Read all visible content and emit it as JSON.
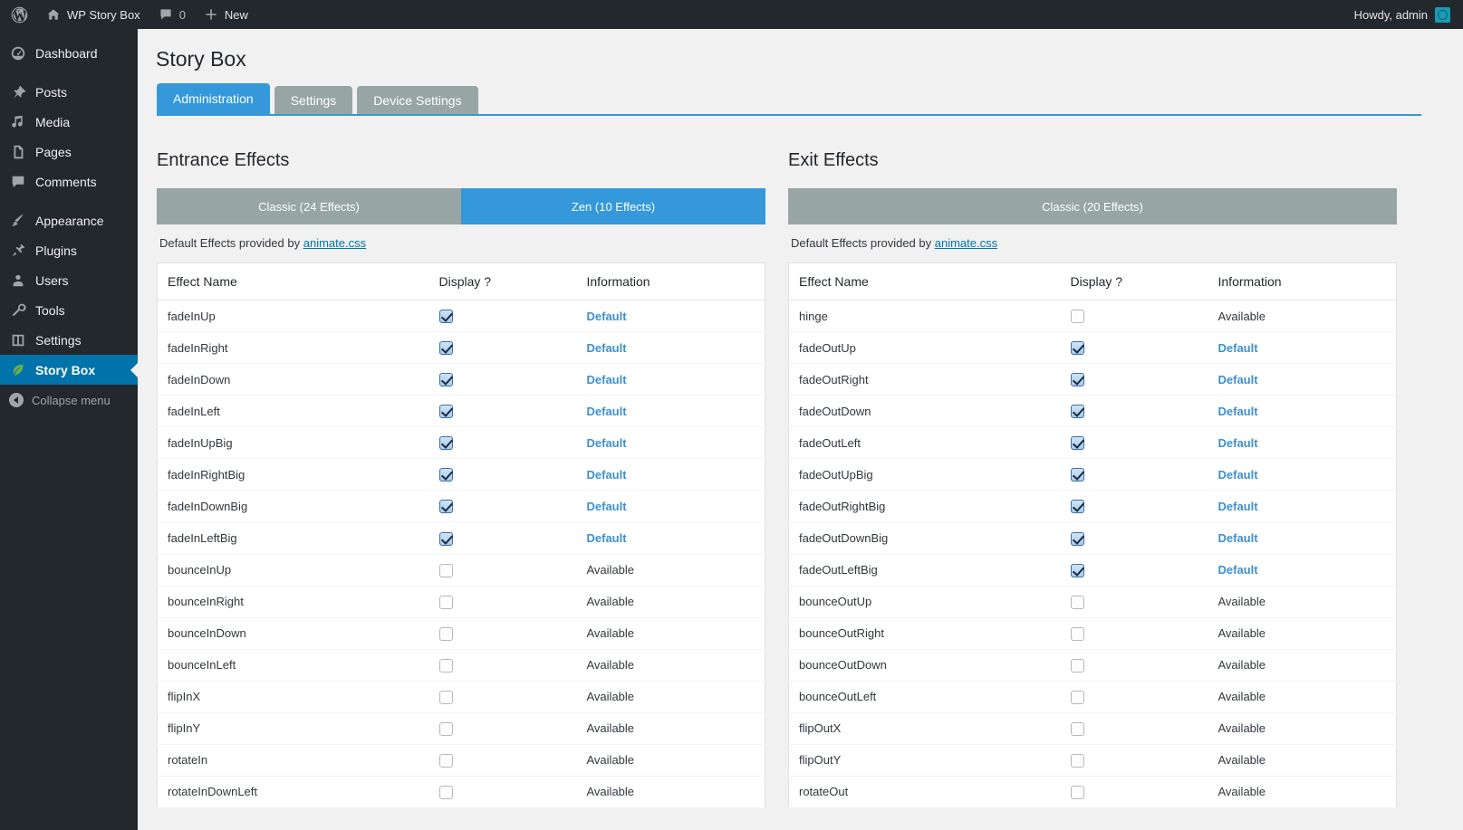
{
  "adminbar": {
    "logo_icon": "wordpress-logo-icon",
    "site_name": "WP Story Box",
    "site_icon": "home-icon",
    "comments_icon": "comment-bubble-icon",
    "comments_count": "0",
    "new_icon": "plus-icon",
    "new_label": "New",
    "howdy": "Howdy, admin",
    "avatar_icon": "user-avatar-icon"
  },
  "sidebar": {
    "items": [
      {
        "label": "Dashboard",
        "icon": "dashboard-icon",
        "current": false
      },
      {
        "label": "Posts",
        "icon": "pin-icon",
        "current": false
      },
      {
        "label": "Media",
        "icon": "media-icon",
        "current": false
      },
      {
        "label": "Pages",
        "icon": "pages-icon",
        "current": false
      },
      {
        "label": "Comments",
        "icon": "comment-bubble-icon",
        "current": false
      },
      {
        "label": "Appearance",
        "icon": "paintbrush-icon",
        "current": false
      },
      {
        "label": "Plugins",
        "icon": "plug-icon",
        "current": false
      },
      {
        "label": "Users",
        "icon": "user-icon",
        "current": false
      },
      {
        "label": "Tools",
        "icon": "wrench-icon",
        "current": false
      },
      {
        "label": "Settings",
        "icon": "sliders-icon",
        "current": false
      },
      {
        "label": "Story Box",
        "icon": "leaf-icon",
        "current": true
      }
    ],
    "collapse_label": "Collapse menu",
    "collapse_icon": "collapse-arrow-icon"
  },
  "page": {
    "title": "Story Box",
    "tabs": [
      {
        "label": "Administration",
        "active": true
      },
      {
        "label": "Settings",
        "active": false
      },
      {
        "label": "Device Settings",
        "active": false
      }
    ]
  },
  "colors": {
    "accent_blue": "#3498db",
    "tab_inactive_gray": "#97a5a5",
    "sidebar_current": "#0073aa",
    "link_blue": "#0073aa",
    "default_label": "#3d90d0",
    "admin_bar": "#23282d"
  },
  "columns": [
    {
      "title": "Entrance Effects",
      "toggles": [
        {
          "label": "Classic (24 Effects)",
          "active": false
        },
        {
          "label": "Zen (10 Effects)",
          "active": true
        }
      ],
      "provided_prefix": "Default Effects provided by ",
      "provided_link": "animate.css",
      "headers": [
        "Effect Name",
        "Display ?",
        "Information"
      ],
      "rows": [
        {
          "name": "fadeInUp",
          "checked": true,
          "info": "Default"
        },
        {
          "name": "fadeInRight",
          "checked": true,
          "info": "Default"
        },
        {
          "name": "fadeInDown",
          "checked": true,
          "info": "Default"
        },
        {
          "name": "fadeInLeft",
          "checked": true,
          "info": "Default"
        },
        {
          "name": "fadeInUpBig",
          "checked": true,
          "info": "Default"
        },
        {
          "name": "fadeInRightBig",
          "checked": true,
          "info": "Default"
        },
        {
          "name": "fadeInDownBig",
          "checked": true,
          "info": "Default"
        },
        {
          "name": "fadeInLeftBig",
          "checked": true,
          "info": "Default"
        },
        {
          "name": "bounceInUp",
          "checked": false,
          "info": "Available"
        },
        {
          "name": "bounceInRight",
          "checked": false,
          "info": "Available"
        },
        {
          "name": "bounceInDown",
          "checked": false,
          "info": "Available"
        },
        {
          "name": "bounceInLeft",
          "checked": false,
          "info": "Available"
        },
        {
          "name": "flipInX",
          "checked": false,
          "info": "Available"
        },
        {
          "name": "flipInY",
          "checked": false,
          "info": "Available"
        },
        {
          "name": "rotateIn",
          "checked": false,
          "info": "Available"
        },
        {
          "name": "rotateInDownLeft",
          "checked": false,
          "info": "Available"
        }
      ]
    },
    {
      "title": "Exit Effects",
      "toggles": [
        {
          "label": "Classic (20 Effects)",
          "active": false
        }
      ],
      "provided_prefix": "Default Effects provided by ",
      "provided_link": "animate.css",
      "headers": [
        "Effect Name",
        "Display ?",
        "Information"
      ],
      "rows": [
        {
          "name": "hinge",
          "checked": false,
          "info": "Available"
        },
        {
          "name": "fadeOutUp",
          "checked": true,
          "info": "Default"
        },
        {
          "name": "fadeOutRight",
          "checked": true,
          "info": "Default"
        },
        {
          "name": "fadeOutDown",
          "checked": true,
          "info": "Default"
        },
        {
          "name": "fadeOutLeft",
          "checked": true,
          "info": "Default"
        },
        {
          "name": "fadeOutUpBig",
          "checked": true,
          "info": "Default"
        },
        {
          "name": "fadeOutRightBig",
          "checked": true,
          "info": "Default"
        },
        {
          "name": "fadeOutDownBig",
          "checked": true,
          "info": "Default"
        },
        {
          "name": "fadeOutLeftBig",
          "checked": true,
          "info": "Default"
        },
        {
          "name": "bounceOutUp",
          "checked": false,
          "info": "Available"
        },
        {
          "name": "bounceOutRight",
          "checked": false,
          "info": "Available"
        },
        {
          "name": "bounceOutDown",
          "checked": false,
          "info": "Available"
        },
        {
          "name": "bounceOutLeft",
          "checked": false,
          "info": "Available"
        },
        {
          "name": "flipOutX",
          "checked": false,
          "info": "Available"
        },
        {
          "name": "flipOutY",
          "checked": false,
          "info": "Available"
        },
        {
          "name": "rotateOut",
          "checked": false,
          "info": "Available"
        }
      ]
    }
  ]
}
